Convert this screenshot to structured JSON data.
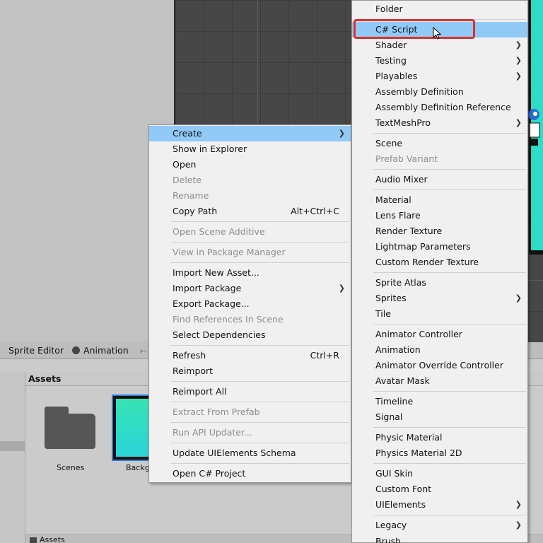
{
  "bottom_tabs": {
    "sprite_editor": "Sprite Editor",
    "animation": "Animation"
  },
  "project": {
    "assets_header": "Assets",
    "scenes_label": "Scenes",
    "background_label": "Backgr",
    "footer_path": "Assets"
  },
  "context_menu": {
    "create": "Create",
    "show_in_explorer": "Show in Explorer",
    "open": "Open",
    "delete": "Delete",
    "rename": "Rename",
    "copy_path": "Copy Path",
    "copy_path_shortcut": "Alt+Ctrl+C",
    "open_scene_additive": "Open Scene Additive",
    "view_in_package_manager": "View in Package Manager",
    "import_new_asset": "Import New Asset...",
    "import_package": "Import Package",
    "export_package": "Export Package...",
    "find_references": "Find References In Scene",
    "select_dependencies": "Select Dependencies",
    "refresh": "Refresh",
    "refresh_shortcut": "Ctrl+R",
    "reimport": "Reimport",
    "reimport_all": "Reimport All",
    "extract_from_prefab": "Extract From Prefab",
    "run_api_updater": "Run API Updater...",
    "update_uielements": "Update UIElements Schema",
    "open_csharp_project": "Open C# Project"
  },
  "create_submenu": {
    "folder": "Folder",
    "csharp_script": "C# Script",
    "shader": "Shader",
    "testing": "Testing",
    "playables": "Playables",
    "assembly_definition": "Assembly Definition",
    "assembly_definition_reference": "Assembly Definition Reference",
    "textmeshpro": "TextMeshPro",
    "scene": "Scene",
    "prefab_variant": "Prefab Variant",
    "audio_mixer": "Audio Mixer",
    "material": "Material",
    "lens_flare": "Lens Flare",
    "render_texture": "Render Texture",
    "lightmap_parameters": "Lightmap Parameters",
    "custom_render_texture": "Custom Render Texture",
    "sprite_atlas": "Sprite Atlas",
    "sprites": "Sprites",
    "tile": "Tile",
    "animator_controller": "Animator Controller",
    "animation": "Animation",
    "animator_override_controller": "Animator Override Controller",
    "avatar_mask": "Avatar Mask",
    "timeline": "Timeline",
    "signal": "Signal",
    "physic_material": "Physic Material",
    "physics_material_2d": "Physics Material 2D",
    "gui_skin": "GUI Skin",
    "custom_font": "Custom Font",
    "uielements": "UIElements",
    "legacy": "Legacy",
    "brush": "Brush"
  },
  "colors": {
    "highlight": "#91c9f7",
    "annotation": "#e0302a"
  }
}
